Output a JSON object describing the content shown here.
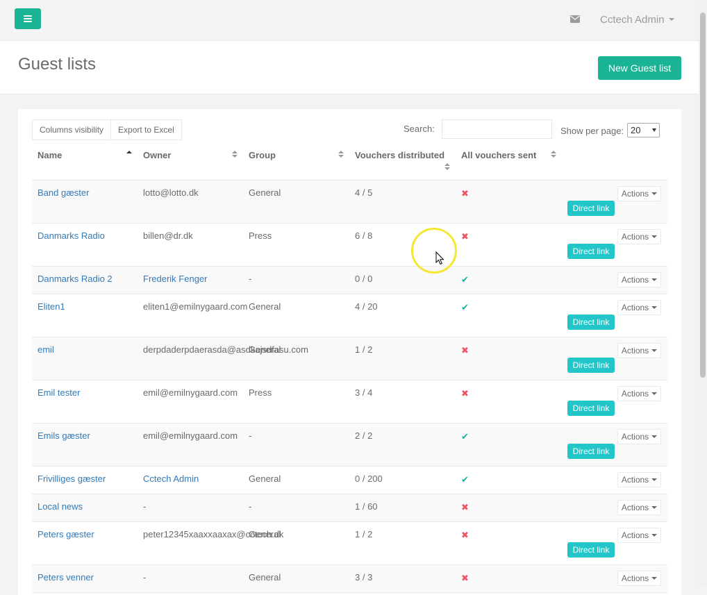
{
  "topbar": {
    "user_name": "Cctech Admin"
  },
  "heading": {
    "title": "Guest lists",
    "new_button": "New Guest list"
  },
  "toolbar": {
    "columns_visibility": "Columns visibility",
    "export_excel": "Export to Excel",
    "search_label": "Search:",
    "search_value": "",
    "per_page_label": "Show per page:",
    "per_page_value": "20"
  },
  "table": {
    "columns": {
      "name": "Name",
      "owner": "Owner",
      "group": "Group",
      "vouchers": "Vouchers distributed",
      "sent": "All vouchers sent"
    },
    "actions_label": "Actions",
    "direct_link_label": "Direct link",
    "rows": [
      {
        "name": "Band gæster",
        "owner": "lotto@lotto.dk",
        "group": "General",
        "vouchers": "4 / 5",
        "sent": "✖"
      },
      {
        "name": "Danmarks Radio",
        "owner": "billen@dr.dk",
        "group": "Press",
        "vouchers": "6 / 8",
        "sent": "✖"
      },
      {
        "name": "Danmarks Radio 2",
        "owner": "Frederik Fenger",
        "group": "-",
        "vouchers": "0 / 0",
        "sent": "✔"
      },
      {
        "name": "Eliten1",
        "owner": "eliten1@emilnygaard.com",
        "group": "General",
        "vouchers": "4 / 20",
        "sent": "✔"
      },
      {
        "name": "emil",
        "owner": "derpdaderpdaerasda@asdkajsdfasu.com",
        "group": "General",
        "vouchers": "1 / 2",
        "sent": "✖"
      },
      {
        "name": "Emil tester",
        "owner": "emil@emilnygaard.com",
        "group": "Press",
        "vouchers": "3 / 4",
        "sent": "✖"
      },
      {
        "name": "Emils gæster",
        "owner": "emil@emilnygaard.com",
        "group": "-",
        "vouchers": "2 / 2",
        "sent": "✔"
      },
      {
        "name": "Frivilliges gæster",
        "owner": "Cctech Admin",
        "group": "General",
        "vouchers": "0 / 200",
        "sent": "✔"
      },
      {
        "name": "Local news",
        "owner": "-",
        "group": "-",
        "vouchers": "1 / 60",
        "sent": "✖"
      },
      {
        "name": "Peters gæster",
        "owner": "peter12345xaaxxaaxax@cctech.dk",
        "group": "General",
        "vouchers": "1 / 2",
        "sent": "✖"
      },
      {
        "name": "Peters venner",
        "owner": "-",
        "group": "General",
        "vouchers": "3 / 3",
        "sent": "✖"
      }
    ]
  },
  "colors": {
    "primary": "#1ab394",
    "info": "#23c6c8",
    "danger": "#ed5565",
    "link": "#337ab7"
  }
}
